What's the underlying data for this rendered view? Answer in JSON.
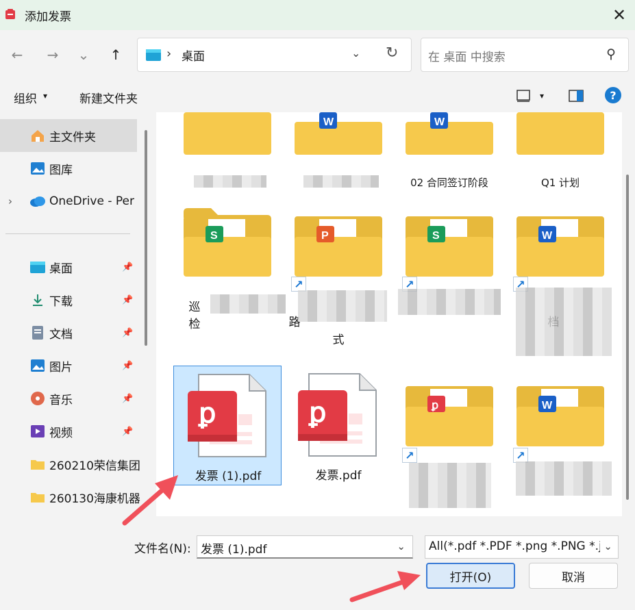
{
  "window": {
    "title": "添加发票",
    "close_glyph": "✕"
  },
  "nav": {
    "back": "←",
    "forward": "→",
    "recent": "⌄",
    "up": "↑"
  },
  "address": {
    "separator": "›",
    "location": "桌面",
    "dropdown": "⌄",
    "refresh": "↻"
  },
  "search": {
    "placeholder": "在 桌面 中搜索",
    "icon": "⚲"
  },
  "toolbar": {
    "organize": "组织",
    "organize_caret": "▾",
    "new_folder": "新建文件夹",
    "view_caret": "▾",
    "help": "?"
  },
  "sidebar": {
    "items": [
      {
        "label": "主文件夹",
        "icon": "home-icon",
        "active": true
      },
      {
        "label": "图库",
        "icon": "gallery-icon"
      },
      {
        "label": "OneDrive - Per",
        "icon": "cloud-icon",
        "expander": "›"
      },
      {
        "label": "桌面",
        "icon": "desktop-icon",
        "pinned": true
      },
      {
        "label": "下载",
        "icon": "download-icon",
        "pinned": true
      },
      {
        "label": "文档",
        "icon": "document-icon",
        "pinned": true
      },
      {
        "label": "图片",
        "icon": "pictures-icon",
        "pinned": true
      },
      {
        "label": "音乐",
        "icon": "music-icon",
        "pinned": true
      },
      {
        "label": "视频",
        "icon": "video-icon",
        "pinned": true
      },
      {
        "label": "260210荣信集团",
        "icon": "folder-icon"
      },
      {
        "label": "260130海康机器",
        "icon": "folder-icon"
      }
    ],
    "pin_glyph": "📌"
  },
  "files": {
    "row1_partial_labels": [
      "",
      "",
      "02 合同签订阶段",
      "Q1 计划"
    ],
    "row2": [
      {
        "label": "巡检",
        "badge": "S"
      },
      {
        "label": "路",
        "label2": "式",
        "badge": "P"
      },
      {
        "label": "",
        "badge": "S"
      },
      {
        "label": "档",
        "badge": "W"
      }
    ],
    "pdf1": {
      "name": "发票 (1).pdf",
      "selected": true
    },
    "pdf2": {
      "name": "发票.pdf"
    },
    "shortcut_glyph": "↗"
  },
  "bottom": {
    "filename_label": "文件名(N):",
    "filename_value": "发票 (1).pdf",
    "filetype_value": "All(*.pdf *.PDF *.png *.PNG *.jpg",
    "dropdown": "⌄",
    "open_label": "打开(O)",
    "cancel_label": "取消"
  },
  "colors": {
    "accent": "#3a7bd5",
    "folder": "#f6c94c",
    "pdf": "#e23b45",
    "selected": "#cce8ff"
  }
}
